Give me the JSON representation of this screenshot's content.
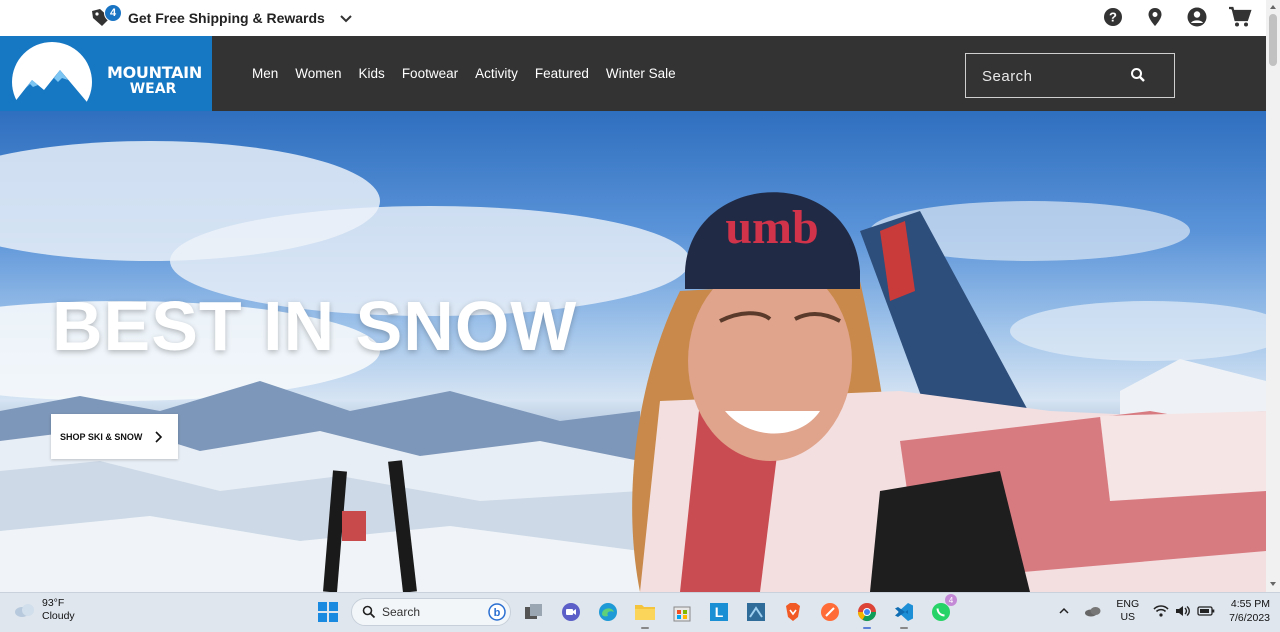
{
  "promo": {
    "badge_count": "4",
    "text": "Get Free Shipping & Rewards"
  },
  "utility_icons": [
    "help-icon",
    "location-pin-icon",
    "account-icon",
    "cart-icon"
  ],
  "logo": {
    "line1": "MOUNTAIN",
    "line2": "WEAR"
  },
  "nav": {
    "items": [
      "Men",
      "Women",
      "Kids",
      "Footwear",
      "Activity",
      "Featured",
      "Winter Sale"
    ]
  },
  "search": {
    "placeholder": "Search"
  },
  "hero": {
    "title": "BEST IN SNOW",
    "cta_label": "SHOP SKI & SNOW",
    "beanie_text": "umb"
  },
  "taskbar": {
    "weather_temp": "93°F",
    "weather_desc": "Cloudy",
    "search_label": "Search",
    "whatsapp_badge": "4",
    "lang_line1": "ENG",
    "lang_line2": "US",
    "time": "4:55 PM",
    "date": "7/6/2023"
  },
  "colors": {
    "brand_blue": "#1677c2",
    "header_bg": "#333333",
    "badge_blue": "#1a74c4"
  }
}
